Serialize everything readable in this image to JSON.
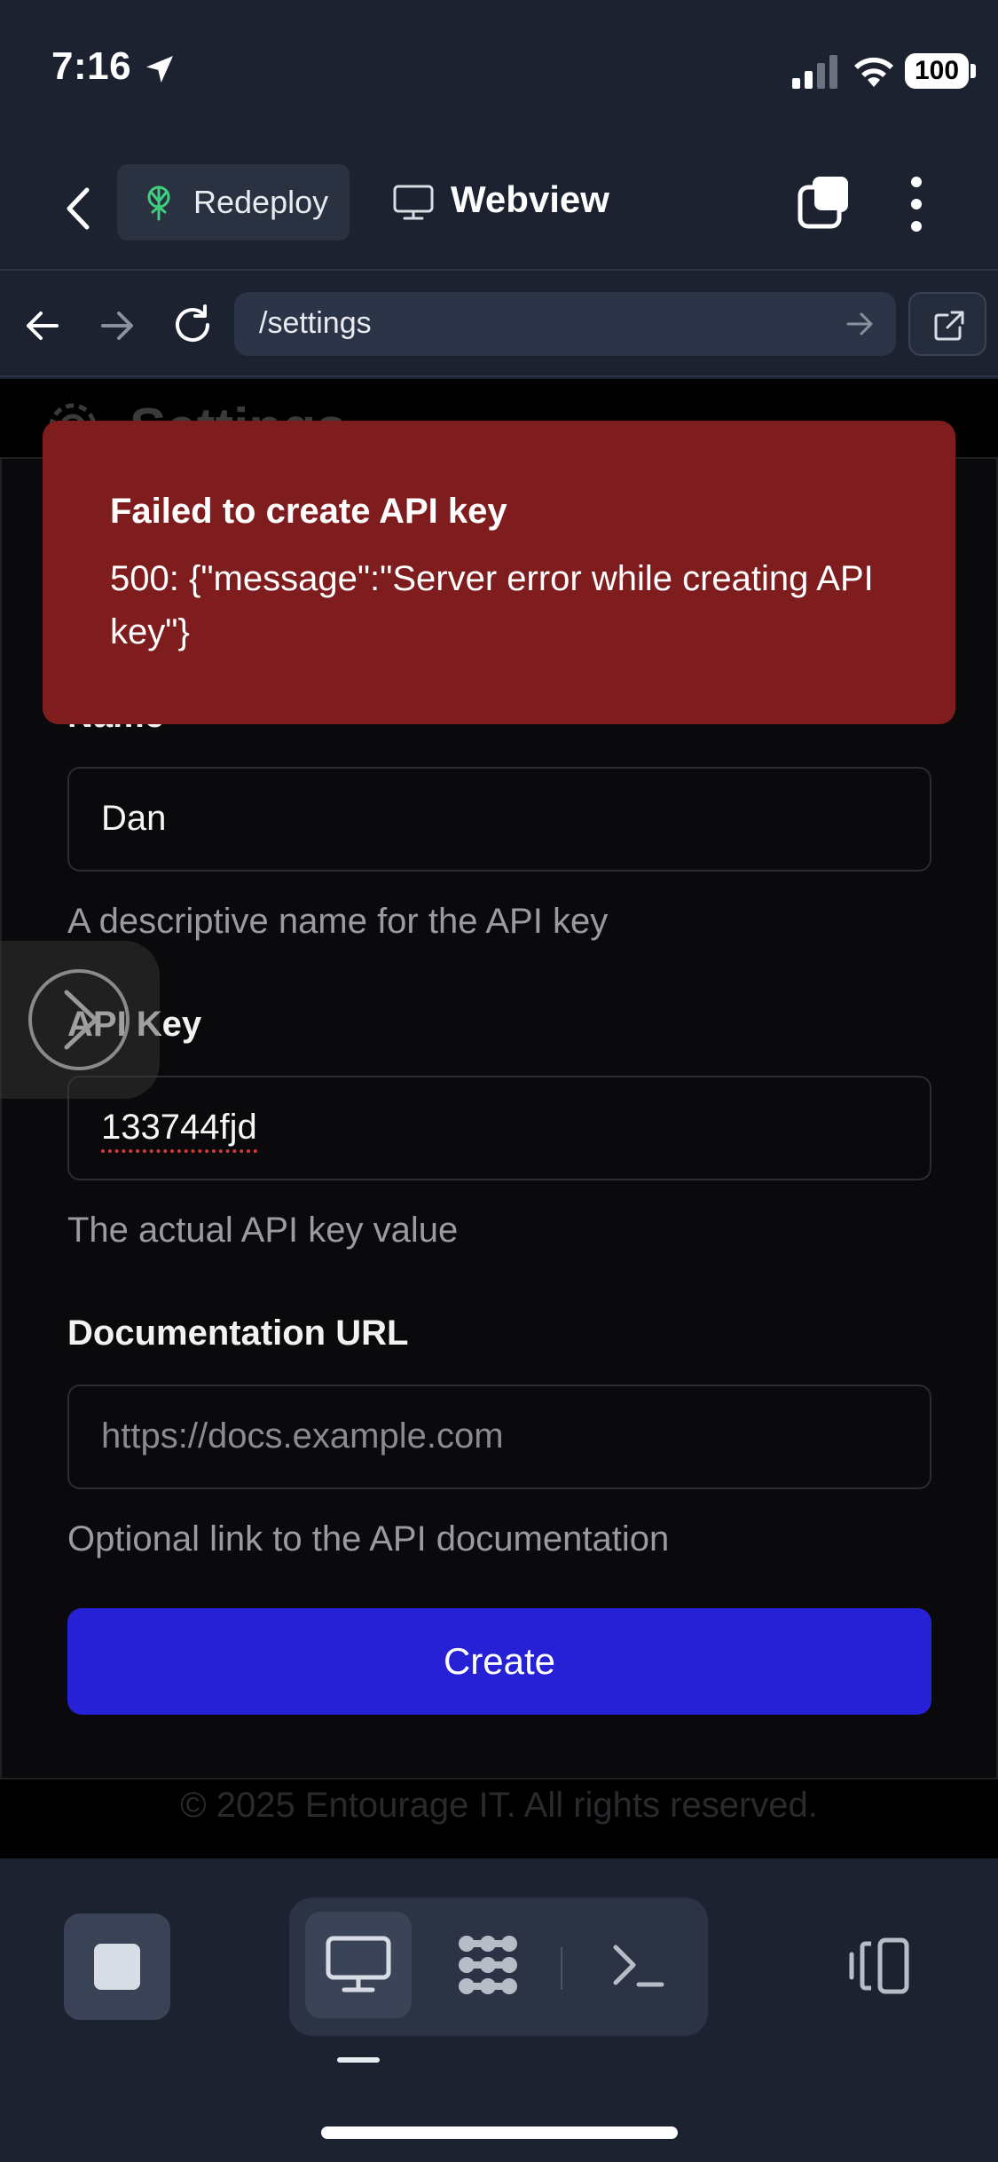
{
  "status_bar": {
    "time": "7:16",
    "battery": "100"
  },
  "header": {
    "app_tab": "Redeploy",
    "webview_title": "Webview"
  },
  "url_bar": {
    "url": "/settings"
  },
  "page": {
    "title": "Settings"
  },
  "toast": {
    "title": "Failed to create API key",
    "message": "500: {\"message\":\"Server error while creating API key\"}"
  },
  "form": {
    "name": {
      "label": "Name",
      "value": "Dan",
      "help": "A descriptive name for the API key"
    },
    "api_key": {
      "label": "API Key",
      "value": "133744fjd",
      "help": "The actual API key value"
    },
    "doc_url": {
      "label": "Documentation URL",
      "placeholder": "https://docs.example.com",
      "help": "Optional link to the API documentation"
    },
    "submit_label": "Create"
  },
  "footer": {
    "text": "© 2025 Entourage IT. All rights reserved."
  },
  "colors": {
    "toast_bg": "#7f1c1d",
    "primary_button": "#2721d6",
    "app_bg": "#1c2230"
  },
  "icons": [
    "location-arrow-icon",
    "signal-icon",
    "wifi-icon",
    "back-chevron-icon",
    "redeploy-logo-icon",
    "monitor-icon",
    "tabs-icon",
    "more-vertical-icon",
    "arrow-left-icon",
    "arrow-right-icon",
    "reload-icon",
    "open-external-icon",
    "chevron-right-icon",
    "stop-icon",
    "grid-icon",
    "terminal-icon",
    "split-view-icon"
  ]
}
